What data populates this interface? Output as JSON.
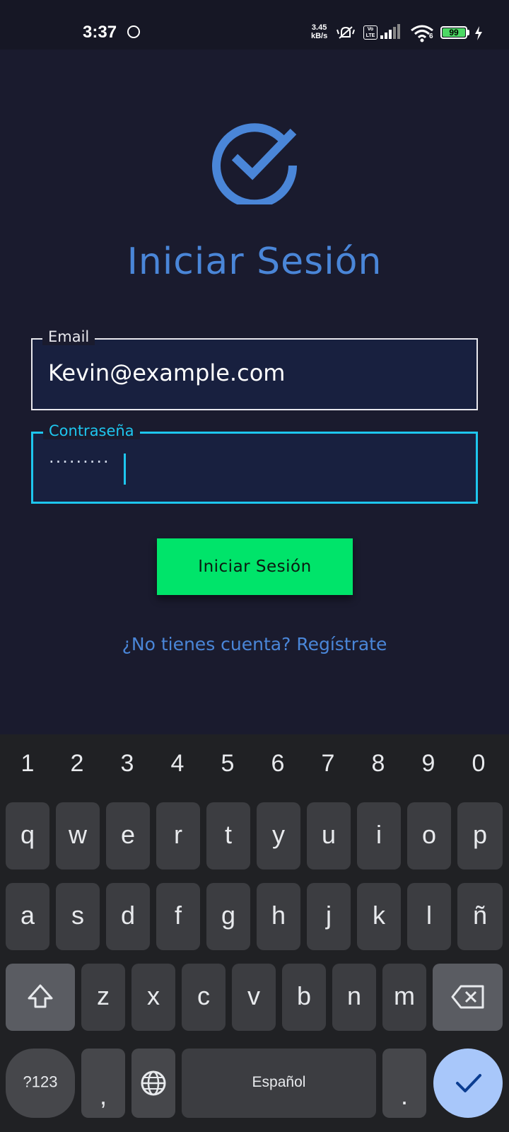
{
  "status_bar": {
    "time": "3:37",
    "net_speed_value": "3.45",
    "net_speed_unit": "kB/s",
    "volte_top": "Vo",
    "volte_bottom": "LTE",
    "wifi_badge": "6",
    "battery": "99"
  },
  "login": {
    "title": "Iniciar Sesión",
    "email": {
      "label": "Email",
      "value": "Kevin@example.com"
    },
    "password": {
      "label": "Contraseña",
      "masked_value": "·········"
    },
    "submit_label": "Iniciar Sesión",
    "register_link": "¿No tienes cuenta? Regístrate"
  },
  "keyboard": {
    "numbers": [
      "1",
      "2",
      "3",
      "4",
      "5",
      "6",
      "7",
      "8",
      "9",
      "0"
    ],
    "row1": [
      "q",
      "w",
      "e",
      "r",
      "t",
      "y",
      "u",
      "i",
      "o",
      "p"
    ],
    "row2": [
      "a",
      "s",
      "d",
      "f",
      "g",
      "h",
      "j",
      "k",
      "l",
      "ñ"
    ],
    "row3": [
      "z",
      "x",
      "c",
      "v",
      "b",
      "n",
      "m"
    ],
    "symbols_label": "?123",
    "comma": ",",
    "space_label": "Español",
    "period": "."
  },
  "colors": {
    "background": "#1a1b2e",
    "accent_blue": "#4a86d8",
    "focus_cyan": "#1ec6ee",
    "button_green": "#00e46a"
  },
  "icons": [
    "check-circle-icon",
    "signal-icon",
    "wifi-icon",
    "battery-icon",
    "charging-icon",
    "mute-icon",
    "shift-icon",
    "backspace-icon",
    "globe-icon",
    "checkmark-icon"
  ]
}
